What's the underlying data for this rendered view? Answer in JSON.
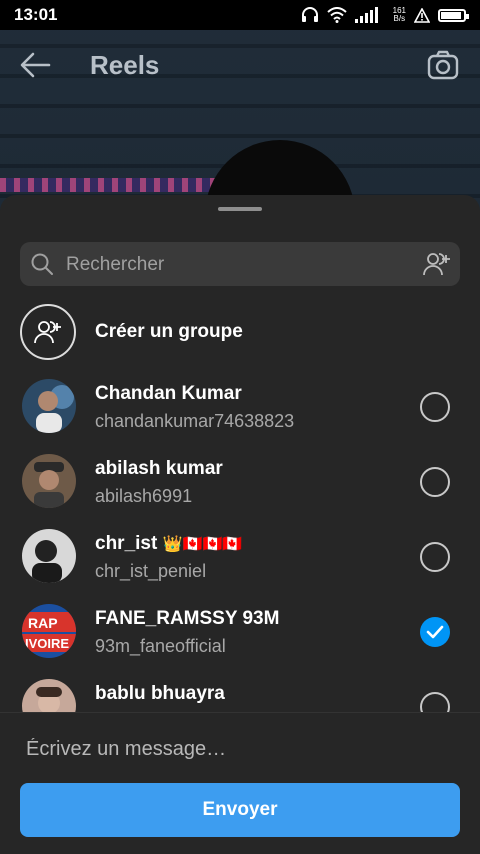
{
  "status_bar": {
    "time": "13:01",
    "net_speed_top": "161",
    "net_speed_bottom": "B/s",
    "battery_level": 0.9,
    "icons": [
      "headphones-icon",
      "wifi-icon",
      "signal-icon",
      "alert-icon",
      "battery-icon"
    ]
  },
  "header": {
    "title": "Reels",
    "back_icon": "arrow-left-icon",
    "camera_icon": "camera-icon"
  },
  "share_sheet": {
    "search": {
      "placeholder": "Rechercher",
      "value": ""
    },
    "create_group_label": "Créer un groupe",
    "contacts": [
      {
        "name": "Chandan Kumar",
        "username": "chandankumar74638823",
        "selected": false,
        "avatar_color": "#5a7ea0"
      },
      {
        "name": "abilash kumar",
        "username": "abilash6991",
        "selected": false,
        "avatar_color": "#5a4a3a"
      },
      {
        "name": "chr_ist",
        "name_suffix": "👑🇨🇦🇨🇦🇨🇦",
        "username": "chr_ist_peniel",
        "selected": false,
        "avatar_color": "#3a3a3a"
      },
      {
        "name": "FANE_RAMSSY 93M",
        "username": "93m_faneofficial",
        "selected": true,
        "avatar_color": "#d8342c",
        "avatar_text_top": "RAP",
        "avatar_text_bottom": "IVOIRE"
      },
      {
        "name": "bablu bhuayra",
        "username": "",
        "selected": false,
        "avatar_color": "#c09a8a"
      }
    ],
    "message_placeholder": "Écrivez un message…",
    "send_label": "Envoyer",
    "accent_color": "#0095f6",
    "send_color": "#3d9df0"
  }
}
